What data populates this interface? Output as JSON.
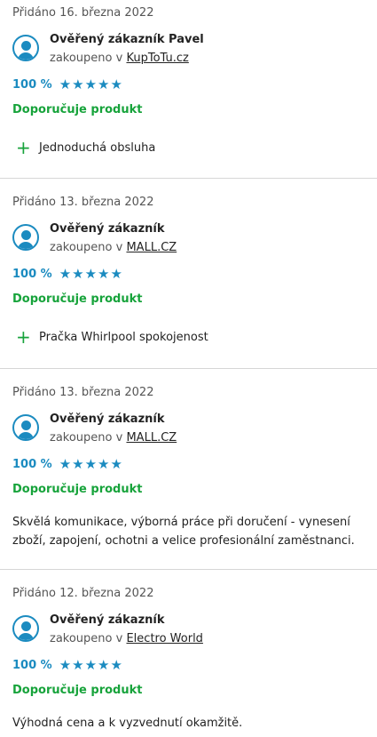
{
  "reviews": [
    {
      "added": "Přidáno 16. března 2022",
      "name": "Ověřený zákazník Pavel",
      "bought_prefix": "zakoupeno v",
      "shop": "KupToTu.cz",
      "percent": "100 %",
      "stars": 5,
      "recommend": "Doporučuje produkt",
      "pro": "Jednoduchá obsluha"
    },
    {
      "added": "Přidáno 13. března 2022",
      "name": "Ověřený zákazník",
      "bought_prefix": "zakoupeno v",
      "shop": "MALL.CZ",
      "percent": "100 %",
      "stars": 5,
      "recommend": "Doporučuje produkt",
      "pro": "Pračka Whirlpool spokojenost"
    },
    {
      "added": "Přidáno 13. března 2022",
      "name": "Ověřený zákazník",
      "bought_prefix": "zakoupeno v",
      "shop": "MALL.CZ",
      "percent": "100 %",
      "stars": 5,
      "recommend": "Doporučuje produkt",
      "text": "Skvělá komunikace, výborná práce při doručení - vynesení zboží, zapojení, ochotni a velice profesionální zaměstnanci."
    },
    {
      "added": "Přidáno 12. března 2022",
      "name": "Ověřený zákazník",
      "bought_prefix": "zakoupeno v",
      "shop": "Electro World",
      "percent": "100 %",
      "stars": 5,
      "recommend": "Doporučuje produkt",
      "text": "Výhodná cena a k vyzvednutí okamžitě."
    }
  ],
  "colors": {
    "accent": "#1b8bc0",
    "recommend": "#17a33b",
    "divider": "#d6d6d6"
  }
}
